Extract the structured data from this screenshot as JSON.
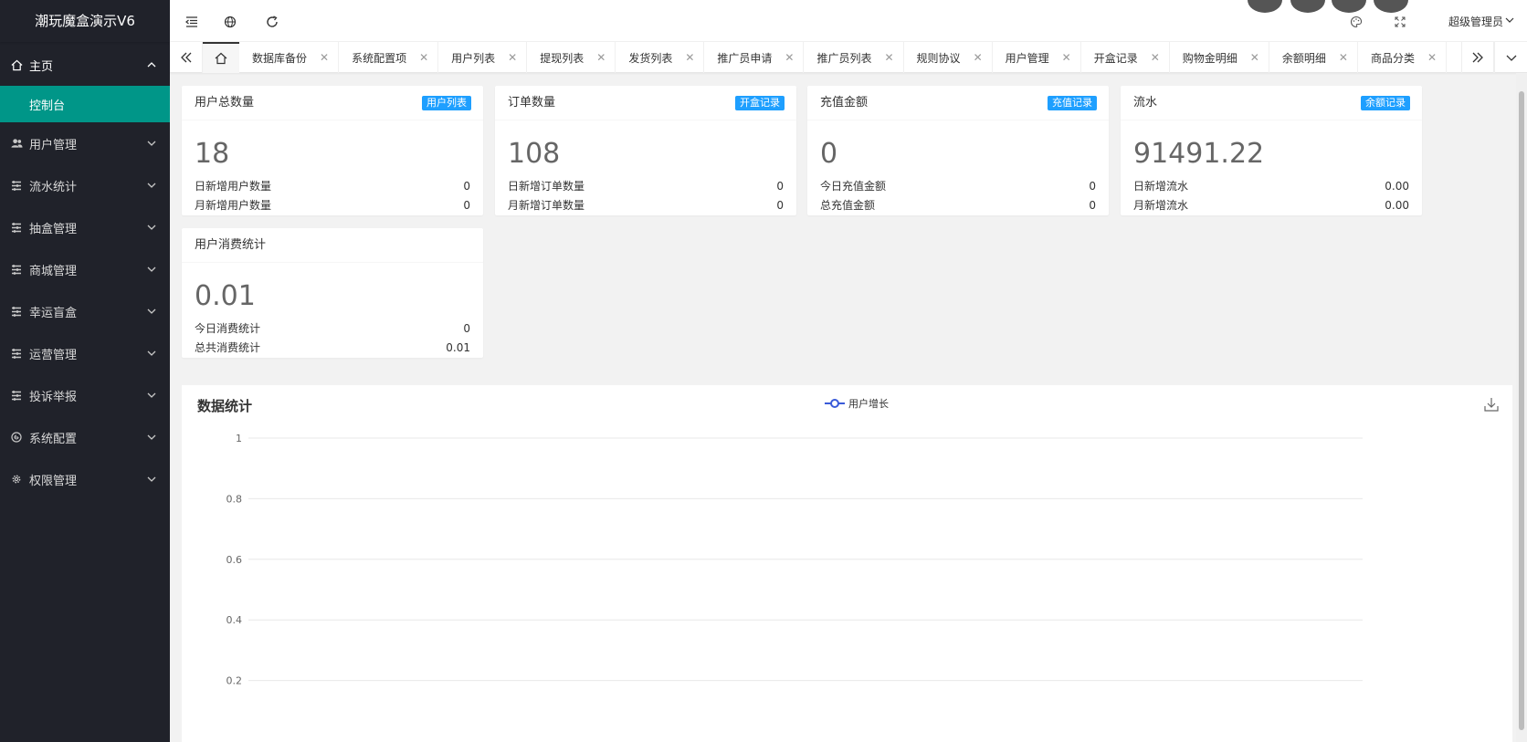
{
  "app": {
    "title": "潮玩魔盒演示V6"
  },
  "sidebar": {
    "home": {
      "label": "主页",
      "icon": "home-icon"
    },
    "home_sub": {
      "label": "控制台"
    },
    "items": [
      {
        "label": "用户管理",
        "icon": "users-icon"
      },
      {
        "label": "流水统计",
        "icon": "list-icon"
      },
      {
        "label": "抽盒管理",
        "icon": "list-icon"
      },
      {
        "label": "商城管理",
        "icon": "list-icon"
      },
      {
        "label": "幸运盲盒",
        "icon": "list-icon"
      },
      {
        "label": "运营管理",
        "icon": "list-icon"
      },
      {
        "label": "投诉举报",
        "icon": "list-icon"
      },
      {
        "label": "系统配置",
        "icon": "settings-circle-icon"
      },
      {
        "label": "权限管理",
        "icon": "gear-icon"
      }
    ]
  },
  "header": {
    "user": "超级管理员"
  },
  "tabs": [
    {
      "label": "数据库备份"
    },
    {
      "label": "系统配置项"
    },
    {
      "label": "用户列表"
    },
    {
      "label": "提现列表"
    },
    {
      "label": "发货列表"
    },
    {
      "label": "推广员申请"
    },
    {
      "label": "推广员列表"
    },
    {
      "label": "规则协议"
    },
    {
      "label": "用户管理"
    },
    {
      "label": "开盒记录"
    },
    {
      "label": "购物金明细"
    },
    {
      "label": "余额明细"
    },
    {
      "label": "商品分类"
    }
  ],
  "cards": [
    {
      "title": "用户总数量",
      "badge": "用户列表",
      "value": "18",
      "rows": [
        {
          "label": "日新增用户数量",
          "value": "0"
        },
        {
          "label": "月新增用户数量",
          "value": "0"
        }
      ]
    },
    {
      "title": "订单数量",
      "badge": "开盒记录",
      "value": "108",
      "rows": [
        {
          "label": "日新增订单数量",
          "value": "0"
        },
        {
          "label": "月新增订单数量",
          "value": "0"
        }
      ]
    },
    {
      "title": "充值金额",
      "badge": "充值记录",
      "value": "0",
      "rows": [
        {
          "label": "今日充值金额",
          "value": "0"
        },
        {
          "label": "总充值金额",
          "value": "0"
        }
      ]
    },
    {
      "title": "流水",
      "badge": "余额记录",
      "value": "91491.22",
      "rows": [
        {
          "label": "日新增流水",
          "value": "0.00"
        },
        {
          "label": "月新增流水",
          "value": "0.00"
        }
      ]
    },
    {
      "title": "用户消费统计",
      "badge": "",
      "value": "0.01",
      "rows": [
        {
          "label": "今日消费统计",
          "value": "0"
        },
        {
          "label": "总共消费统计",
          "value": "0.01"
        }
      ]
    }
  ],
  "chart_data": {
    "type": "line",
    "title": "数据统计",
    "series": [
      {
        "name": "用户增长",
        "values": []
      }
    ],
    "y_ticks": [
      "1",
      "0.8",
      "0.6",
      "0.4",
      "0.2"
    ],
    "ylim": [
      0,
      1
    ],
    "grid": true,
    "legend": "top-center",
    "color": "#3a5bd9"
  },
  "colors": {
    "sidebar_bg": "#20222a",
    "active": "#009688",
    "badge": "#1e9fff"
  }
}
